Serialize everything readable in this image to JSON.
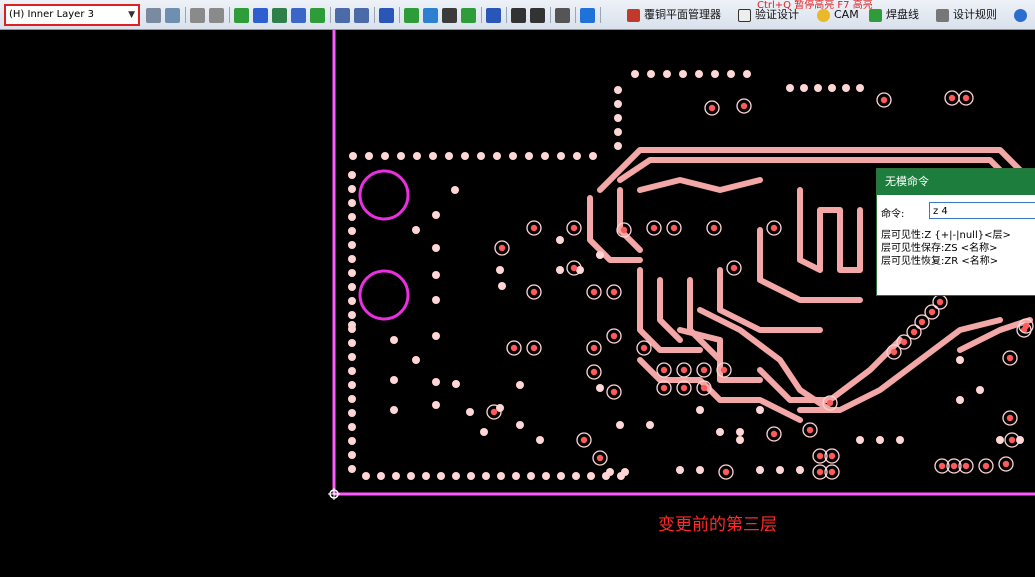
{
  "toolbar": {
    "layer_select": {
      "value": "(H) Inner Layer 3"
    },
    "overlay_text": "Ctrl+Q 暂停高亮  F7 高亮",
    "buttons": {
      "copper_manager": "覆铜平面管理器",
      "verify_design": "验证设计",
      "cam": "CAM",
      "solder_wire": "焊盘线",
      "design_rules": "设计规则"
    }
  },
  "dialog": {
    "title": "无模命令",
    "command_label": "命令:",
    "command_value": "z 4",
    "hints": [
      "层可见性:Z {+|-|null}<层>",
      "层可见性保存:ZS <名称>",
      "层可见性恢复:ZR <名称>"
    ]
  },
  "caption": "变更前的第三层",
  "colors": {
    "board_outline": "#ff5aff",
    "trace": "#f4a7a7",
    "via_fill": "#ffd6d6",
    "background": "#000000",
    "caption": "#ff2a2a",
    "dialog_title": "#1c7d3c"
  }
}
